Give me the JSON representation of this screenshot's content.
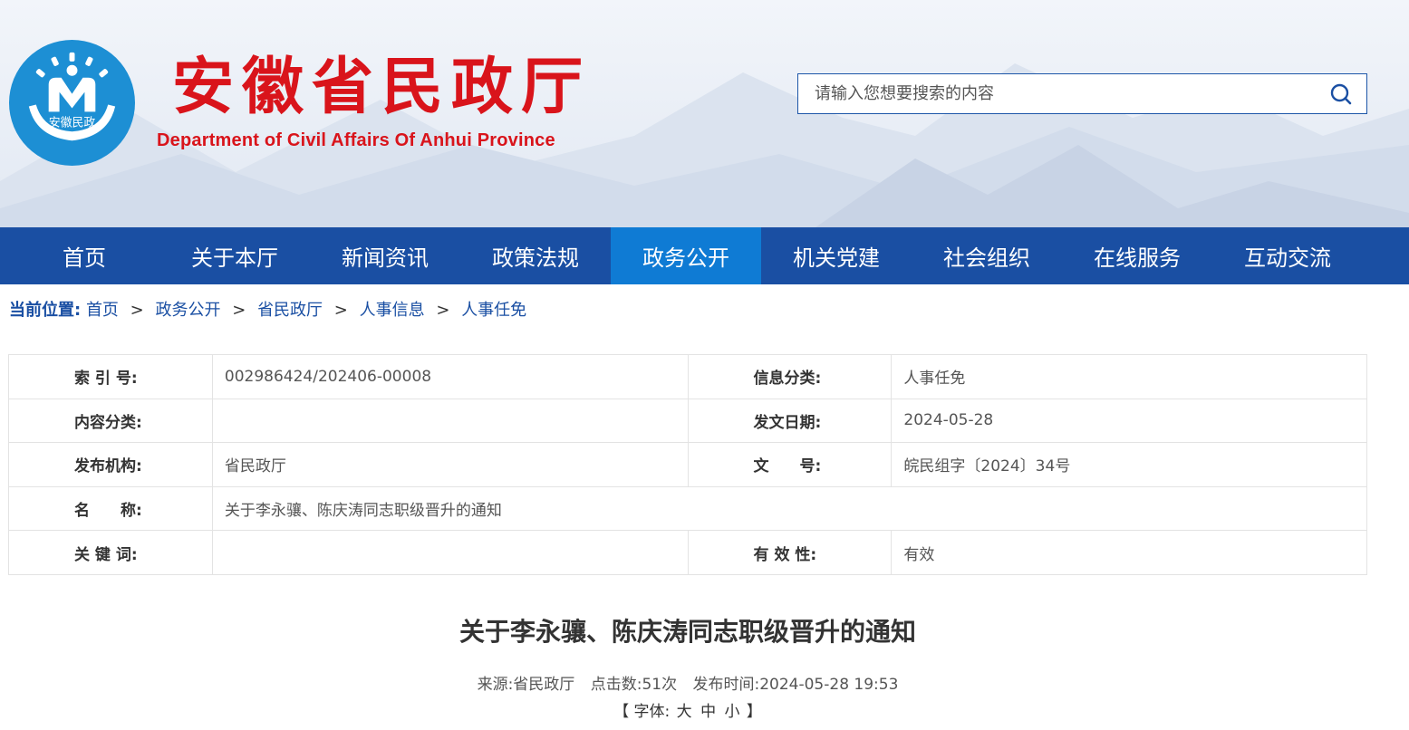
{
  "header": {
    "title": "安徽省民政厅",
    "subtitle": "Department of Civil Affairs Of Anhui Province",
    "logo_text": "安徽民政",
    "brand_red": "#d9141b",
    "brand_blue": "#1a4fa3"
  },
  "search": {
    "placeholder": "请输入您想要搜索的内容",
    "icon": "search-icon"
  },
  "nav": {
    "active_color": "#0f7bd4",
    "items": [
      {
        "label": "首页"
      },
      {
        "label": "关于本厅"
      },
      {
        "label": "新闻资讯"
      },
      {
        "label": "政策法规"
      },
      {
        "label": "政务公开",
        "active": true
      },
      {
        "label": "机关党建"
      },
      {
        "label": "社会组织"
      },
      {
        "label": "在线服务"
      },
      {
        "label": "互动交流"
      }
    ]
  },
  "breadcrumb": {
    "label": "当前位置:",
    "items": [
      "首页",
      "政务公开",
      "省民政厅",
      "人事信息",
      "人事任免"
    ],
    "separator": ">"
  },
  "info": {
    "index_label": "索 引 号:",
    "index_value": "002986424/202406-00008",
    "category_label": "信息分类:",
    "category_value": "人事任免",
    "content_type_label": "内容分类:",
    "content_type_value": "",
    "date_label": "发文日期:",
    "date_value": "2024-05-28",
    "org_label": "发布机构:",
    "org_value": "省民政厅",
    "doc_no_label": "文　　号:",
    "doc_no_value": "皖民组字〔2024〕34号",
    "name_label": "名　　称:",
    "name_value": "关于李永骧、陈庆涛同志职级晋升的通知",
    "keywords_label": "关 键 词:",
    "keywords_value": "",
    "validity_label": "有 效 性:",
    "validity_value": "有效"
  },
  "article": {
    "title": "关于李永骧、陈庆涛同志职级晋升的通知",
    "source": "来源:省民政厅",
    "clicks": "点击数:51次",
    "published": "发布时间:2024-05-28 19:53",
    "font_bracket_open": "【",
    "font_label": "字体:",
    "font_large": "大",
    "font_medium": "中",
    "font_small": "小",
    "font_bracket_close": "】"
  }
}
